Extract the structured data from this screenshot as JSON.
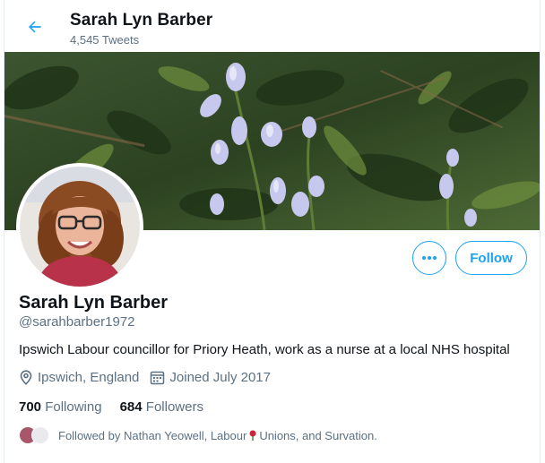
{
  "header": {
    "back_icon": "arrow-left-icon",
    "title": "Sarah Lyn Barber",
    "tweet_count": "4,545 Tweets"
  },
  "profile": {
    "name": "Sarah Lyn Barber",
    "handle": "@sarahbarber1972",
    "bio": "Ipswich Labour councillor for Priory Heath, work as a nurse at a local NHS hospital",
    "location": "Ipswich, England",
    "joined": "Joined July 2017",
    "following_count": "700",
    "following_label": "Following",
    "followers_count": "684",
    "followers_label": "Followers",
    "followed_by": {
      "prefix": "Followed by Nathan Yeowell, Labour",
      "suffix": "Unions, and Survation."
    }
  },
  "actions": {
    "more_icon": "more-dots-icon",
    "follow_label": "Follow"
  },
  "colors": {
    "accent": "#1da1f2",
    "secondary_text": "#5b7083"
  }
}
